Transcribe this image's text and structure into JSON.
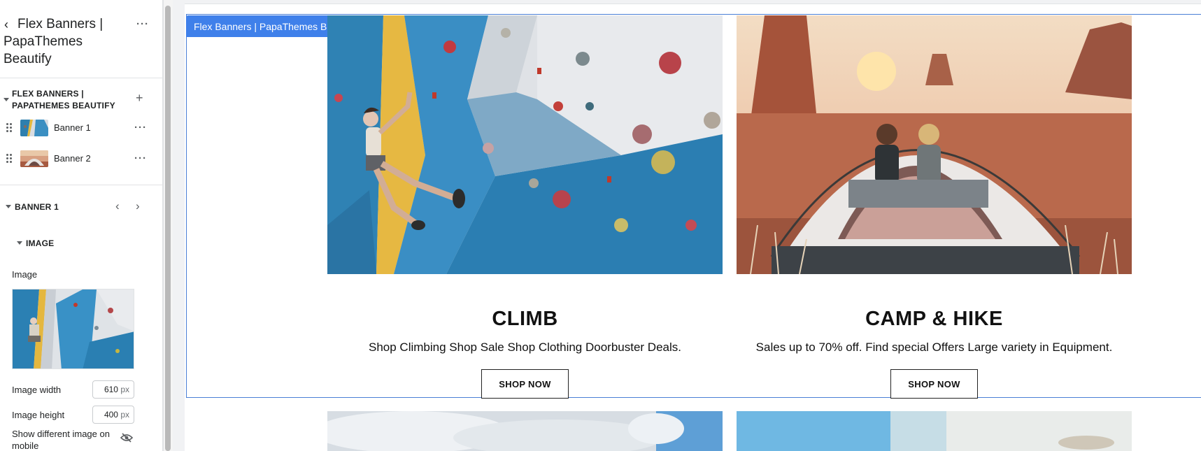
{
  "sidebar": {
    "title": "Flex Banners | PapaThemes Beautify",
    "section": {
      "title": "FLEX BANNERS | PAPATHEMES BEAUTIFY",
      "blocks": [
        {
          "label": "Banner 1",
          "thumb": "climbing"
        },
        {
          "label": "Banner 2",
          "thumb": "tent"
        }
      ]
    },
    "block_settings": {
      "title": "BANNER 1",
      "group_title": "IMAGE",
      "image_label": "Image",
      "image_width_label": "Image width",
      "image_width_value": "610",
      "image_height_label": "Image height",
      "image_height_value": "400",
      "unit": "px",
      "mobile_label": "Show different image on mobile"
    }
  },
  "canvas": {
    "section_tag": "Flex Banners | PapaThemes Beautify",
    "banners": [
      {
        "title": "CLIMB",
        "text": "Shop Climbing Shop Sale Shop Clothing Doorbuster Deals.",
        "button": "SHOP NOW"
      },
      {
        "title": "CAMP & HIKE",
        "text": "Sales up to 70% off. Find special Offers Large variety in Equipment.",
        "button": "SHOP NOW"
      }
    ]
  },
  "colors": {
    "accent": "#3f80ea",
    "selection_border": "#4a7fd6",
    "wall_blue": "#2c86b8",
    "wall_white": "#e6e8eb",
    "desert": "#b5654a"
  }
}
